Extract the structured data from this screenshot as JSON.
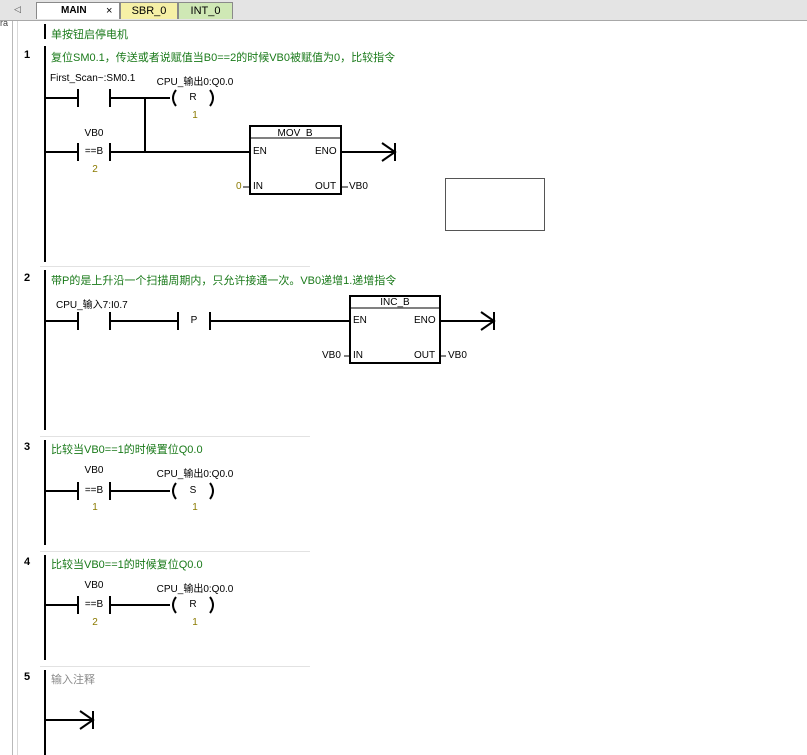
{
  "tabs": [
    {
      "label": "MAIN",
      "close": "×"
    },
    {
      "label": "SBR_0"
    },
    {
      "label": "INT_0"
    }
  ],
  "left_edge_text": "ra",
  "title_comment": "单按钮启停电机",
  "networks": [
    {
      "number": "1",
      "comment": "复位SM0.1，传送或者说赋值当B0==2的时候VB0被赋值为0，比较指令",
      "contacts": [
        {
          "label": "First_Scan~:SM0.1"
        },
        {
          "label": "VB0",
          "compare": "==B",
          "param": "2"
        }
      ],
      "coil": {
        "label": "CPU_输出0:Q0.0",
        "type": "R",
        "param": "1"
      },
      "box": {
        "title": "MOV_B",
        "en": "EN",
        "eno": "ENO",
        "in": "IN",
        "out": "OUT",
        "in_value": "0",
        "out_value": "VB0"
      }
    },
    {
      "number": "2",
      "comment": "带P的是上升沿一个扫描周期内，只允许接通一次。VB0递增1.递增指令",
      "contacts": [
        {
          "label": "CPU_输入7:I0.7"
        },
        {
          "label": "P"
        }
      ],
      "box": {
        "title": "INC_B",
        "en": "EN",
        "eno": "ENO",
        "in": "IN",
        "out": "OUT",
        "in_value": "VB0",
        "out_value": "VB0"
      }
    },
    {
      "number": "3",
      "comment": "比较当VB0==1的时候置位Q0.0",
      "contacts": [
        {
          "label": "VB0",
          "compare": "==B",
          "param": "1"
        }
      ],
      "coil": {
        "label": "CPU_输出0:Q0.0",
        "type": "S",
        "param": "1"
      }
    },
    {
      "number": "4",
      "comment": "比较当VB0==1的时候复位Q0.0",
      "contacts": [
        {
          "label": "VB0",
          "compare": "==B",
          "param": "2"
        }
      ],
      "coil": {
        "label": "CPU_输出0:Q0.0",
        "type": "R",
        "param": "1"
      }
    },
    {
      "number": "5",
      "comment": "输入注释"
    }
  ]
}
